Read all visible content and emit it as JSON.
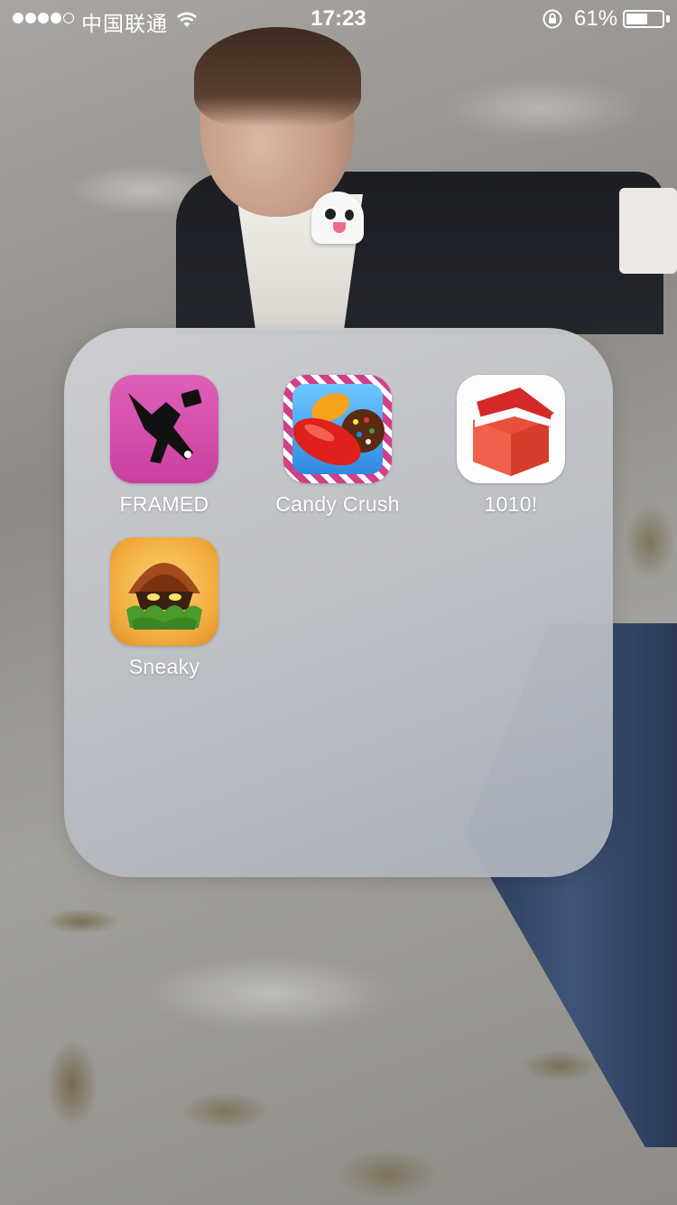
{
  "status_bar": {
    "carrier": "中国联通",
    "time": "17:23",
    "battery_percent": "61%",
    "battery_level": 0.61,
    "signal_bars_filled": 4,
    "signal_bars_total": 5
  },
  "folder": {
    "apps": [
      {
        "label": "FRAMED",
        "icon": "framed-app-icon"
      },
      {
        "label": "Candy Crush",
        "icon": "candy-crush-app-icon"
      },
      {
        "label": "1010!",
        "icon": "1010-app-icon"
      },
      {
        "label": "Sneaky",
        "icon": "sneaky-app-icon"
      }
    ]
  }
}
